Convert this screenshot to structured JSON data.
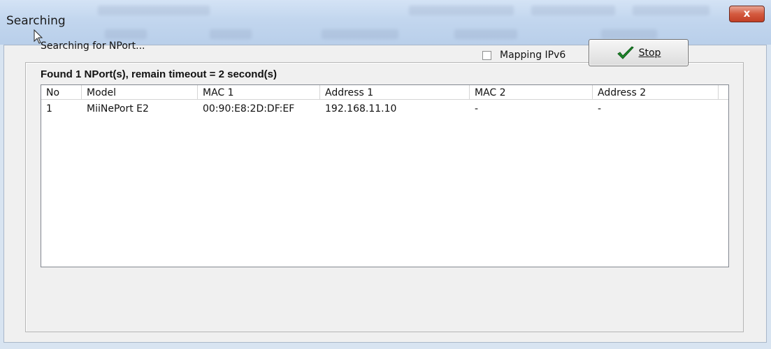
{
  "window": {
    "title": "Searching",
    "close_glyph": "x"
  },
  "status": {
    "text": "Searching for NPort..."
  },
  "summary": {
    "text": "Found 1 NPort(s), remain timeout = 2 second(s)"
  },
  "mapping_ipv6": {
    "label": "Mapping IPv6",
    "checked": false
  },
  "stop_button": {
    "label": "Stop",
    "icon": "checkmark-icon"
  },
  "table": {
    "columns": [
      "No",
      "Model",
      "MAC 1",
      "Address 1",
      "MAC 2",
      "Address 2"
    ],
    "rows": [
      [
        "1",
        "MiiNePort E2",
        "00:90:E8:2D:DF:EF",
        "192.168.11.10",
        "-",
        "-"
      ]
    ]
  }
}
